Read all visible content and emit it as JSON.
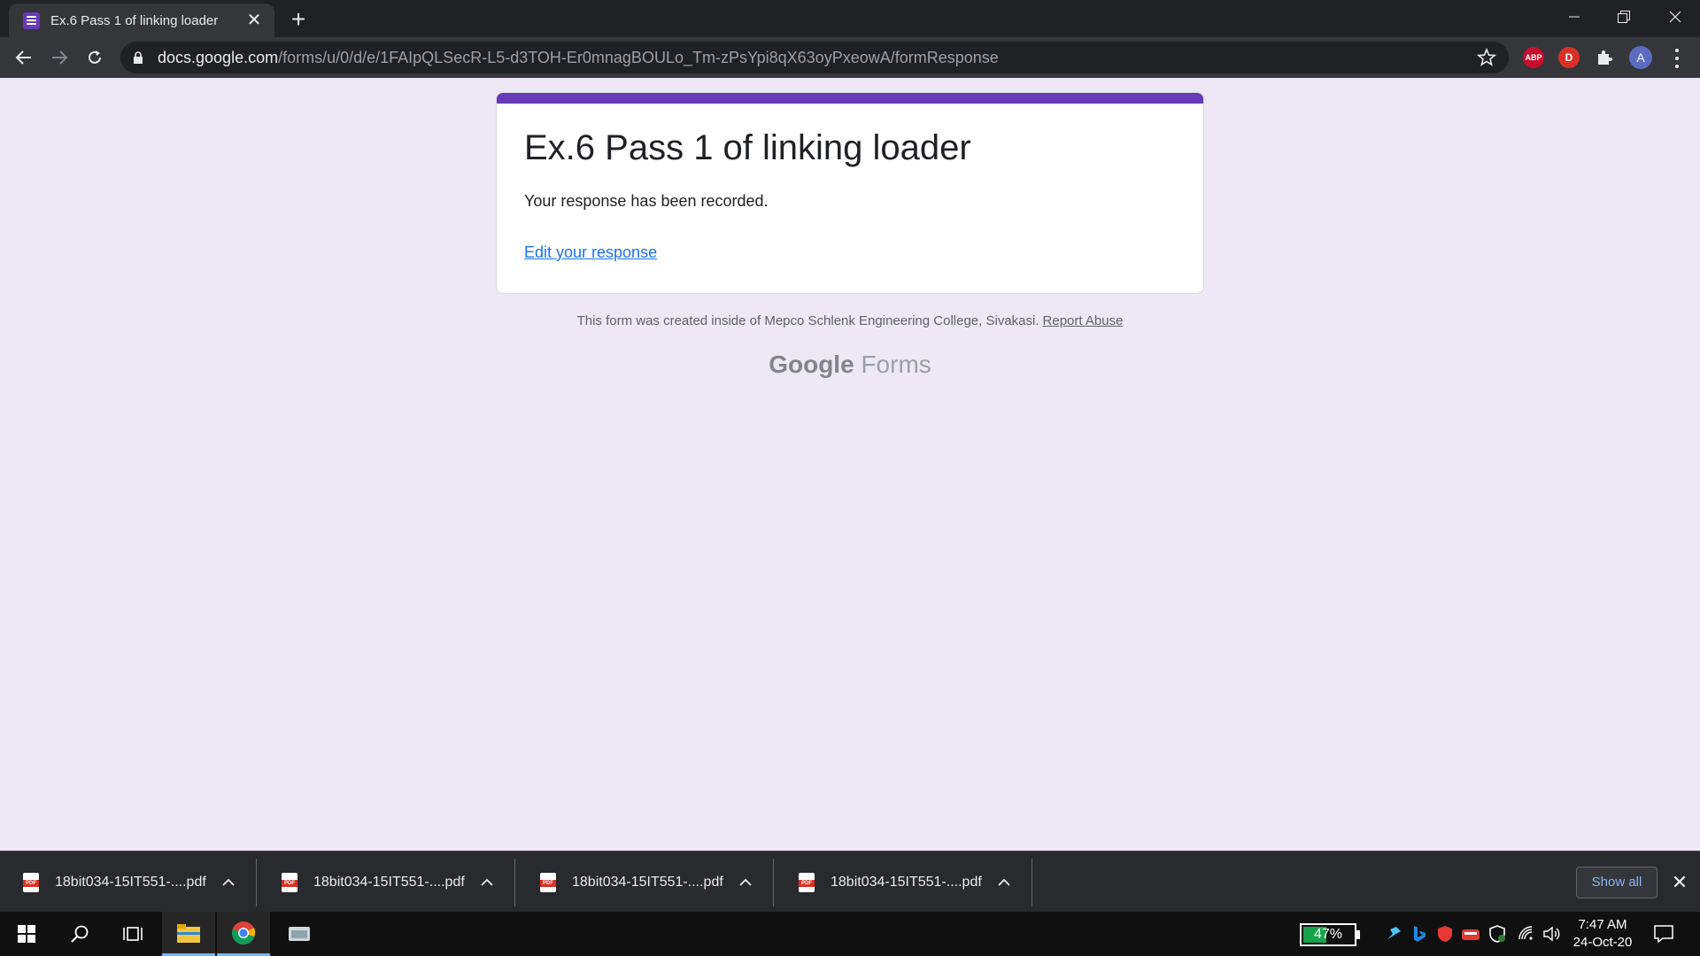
{
  "browser": {
    "tab_title": "Ex.6 Pass 1 of linking loader",
    "url_host": "docs.google.com",
    "url_path": "/forms/u/0/d/e/1FAIpQLSecR-L5-d3TOH-Er0mnagBOULo_Tm-zPsYpi8qX63oyPxeowA/formResponse",
    "extensions": {
      "abp": "ABP",
      "d": "D",
      "avatar": "A"
    }
  },
  "form": {
    "title": "Ex.6 Pass 1 of linking loader",
    "message": "Your response has been recorded.",
    "edit_link": "Edit your response",
    "footer_note": "This form was created inside of Mepco Schlenk Engineering College, Sivakasi.",
    "report_abuse": "Report Abuse",
    "brand_google": "Google",
    "brand_forms": "Forms",
    "accent_color": "#673ab7"
  },
  "downloads": {
    "items": [
      {
        "name": "18bit034-15IT551-....pdf",
        "icon": "pdf-icon"
      },
      {
        "name": "18bit034-15IT551-....pdf",
        "icon": "pdf-icon"
      },
      {
        "name": "18bit034-15IT551-....pdf",
        "icon": "pdf-icon"
      },
      {
        "name": "18bit034-15IT551-....pdf",
        "icon": "pdf-icon"
      }
    ],
    "show_all": "Show all"
  },
  "taskbar": {
    "battery": "47%",
    "battery_level": 0.47,
    "time": "7:47 AM",
    "date": "24-Oct-20"
  }
}
